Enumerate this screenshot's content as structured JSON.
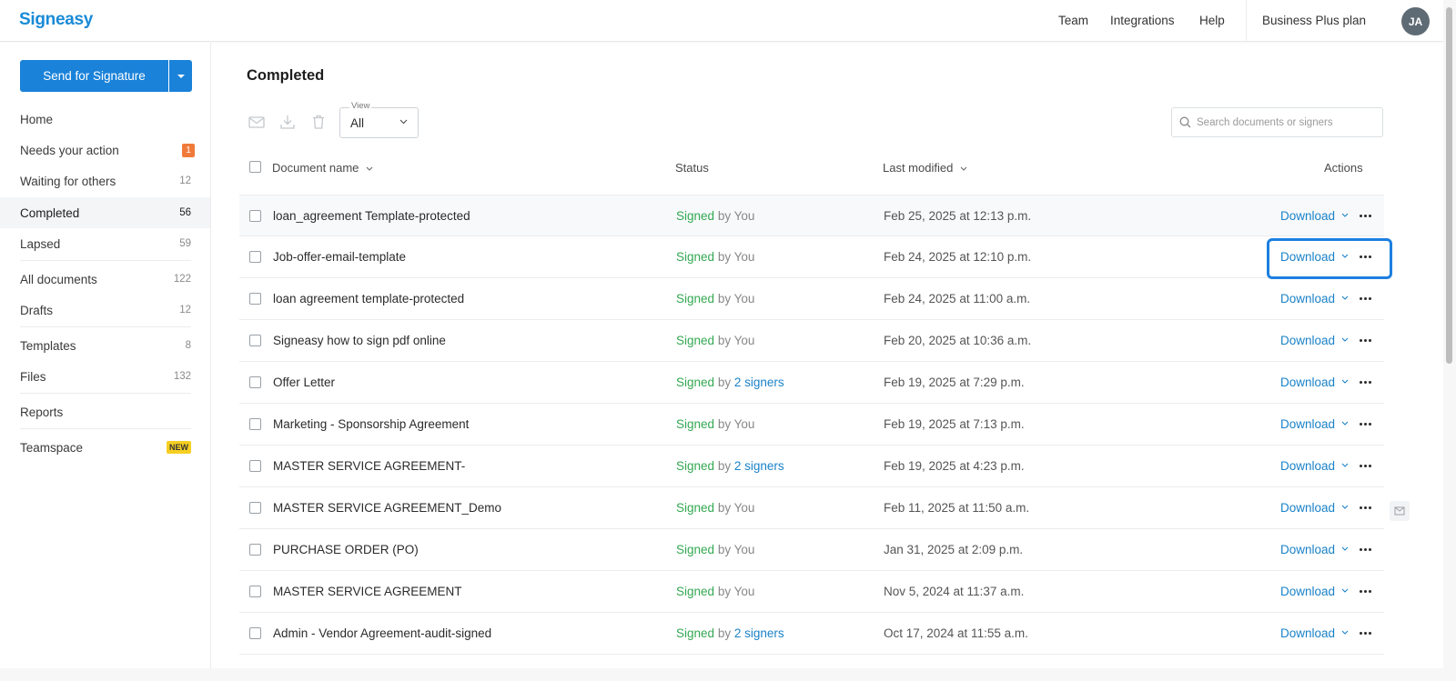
{
  "app": {
    "logo": "Signeasy",
    "brand_color": "#1a8ad6"
  },
  "header": {
    "nav": [
      "Team",
      "Integrations",
      "Help"
    ],
    "plan": "Business Plus plan",
    "avatar_initials": "JA"
  },
  "sidebar": {
    "send_button": "Send for Signature",
    "items": [
      {
        "label": "Home",
        "count": ""
      },
      {
        "label": "Needs your action",
        "count": "1"
      },
      {
        "label": "Waiting for others",
        "count": "12"
      },
      {
        "label": "Completed",
        "count": "56"
      },
      {
        "label": "Lapsed",
        "count": "59"
      },
      {
        "label": "All documents",
        "count": "122"
      },
      {
        "label": "Drafts",
        "count": "12"
      },
      {
        "label": "Templates",
        "count": "8"
      },
      {
        "label": "Files",
        "count": "132"
      },
      {
        "label": "Reports",
        "count": ""
      },
      {
        "label": "Teamspace",
        "badge": "NEW"
      }
    ]
  },
  "main": {
    "title": "Completed",
    "view": {
      "label": "View",
      "value": "All"
    },
    "search_placeholder": "Search documents or signers",
    "columns": {
      "name": "Document name",
      "status": "Status",
      "modified": "Last modified",
      "actions": "Actions"
    },
    "download_label": "Download",
    "signed_word": "Signed",
    "by_word": "by",
    "rows": [
      {
        "name": "loan_agreement Template-protected",
        "signer": "You",
        "date": "Feb 25, 2025 at 12:13 p.m."
      },
      {
        "name": "Job-offer-email-template",
        "signer": "You",
        "date": "Feb 24, 2025 at 12:10 p.m."
      },
      {
        "name": "loan agreement template-protected",
        "signer": "You",
        "date": "Feb 24, 2025 at 11:00 a.m."
      },
      {
        "name": "Signeasy how to sign pdf online",
        "signer": "You",
        "date": "Feb 20, 2025 at 10:36 a.m."
      },
      {
        "name": "Offer Letter",
        "signer": "2 signers",
        "date": "Feb 19, 2025 at 7:29 p.m."
      },
      {
        "name": "Marketing - Sponsorship Agreement",
        "signer": "You",
        "date": "Feb 19, 2025 at 7:13 p.m."
      },
      {
        "name": "MASTER SERVICE AGREEMENT-",
        "signer": "2 signers",
        "date": "Feb 19, 2025 at 4:23 p.m."
      },
      {
        "name": "MASTER SERVICE AGREEMENT_Demo",
        "signer": "You",
        "date": "Feb 11, 2025 at 11:50 a.m."
      },
      {
        "name": "PURCHASE ORDER (PO)",
        "signer": "You",
        "date": "Jan 31, 2025 at 2:09 p.m."
      },
      {
        "name": "MASTER SERVICE AGREEMENT",
        "signer": "You",
        "date": "Nov 5, 2024 at 11:37 a.m."
      },
      {
        "name": "Admin - Vendor Agreement-audit-signed",
        "signer": "2 signers",
        "date": "Oct 17, 2024 at 11:55 a.m."
      }
    ]
  }
}
